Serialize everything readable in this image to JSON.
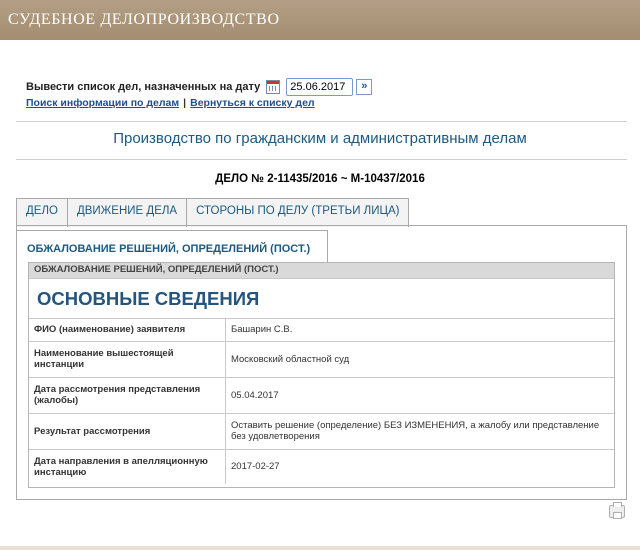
{
  "header": {
    "title": "СУДЕБНОЕ ДЕЛОПРОИЗВОДСТВО"
  },
  "date_filter": {
    "label": "Вывести список дел, назначенных на дату",
    "value": "25.06.2017",
    "go": "»"
  },
  "links": {
    "search": "Поиск информации по делам",
    "separator": "|",
    "back": "Вернуться к списку дел"
  },
  "section_title": "Производство по гражданским и административным делам",
  "case_number": "ДЕЛО № 2-11435/2016 ~ М-10437/2016",
  "tabs": [
    {
      "label": "ДЕЛО"
    },
    {
      "label": "ДВИЖЕНИЕ ДЕЛА"
    },
    {
      "label": "СТОРОНЫ ПО ДЕЛУ (ТРЕТЬИ ЛИЦА)"
    }
  ],
  "active_tab": {
    "label": "ОБЖАЛОВАНИЕ РЕШЕНИЙ, ОПРЕДЕЛЕНИЙ (ПОСТ.)"
  },
  "box": {
    "header": "ОБЖАЛОВАНИЕ РЕШЕНИЙ, ОПРЕДЕЛЕНИЙ (ПОСТ.)",
    "title": "ОСНОВНЫЕ СВЕДЕНИЯ",
    "rows": [
      {
        "key": "ФИО (наименование) заявителя",
        "value": "Башарин С.В."
      },
      {
        "key": "Наименование вышестоящей инстанции",
        "value": "Московский областной суд"
      },
      {
        "key": "Дата рассмотрения представления (жалобы)",
        "value": "05.04.2017"
      },
      {
        "key": "Результат рассмотрения",
        "value": "Оставить решение (определение) БЕЗ ИЗМЕНЕНИЯ, а жалобу или представление без удовлетворения"
      },
      {
        "key": "Дата направления в апелляционную инстанцию",
        "value": "2017-02-27"
      }
    ]
  },
  "colors": {
    "header_bg": "#a89274",
    "link": "#1d4f91",
    "title": "#1c5a80"
  },
  "icons": {
    "calendar": "calendar-icon",
    "go": "double-chevron-right-icon",
    "print": "printer-icon"
  }
}
